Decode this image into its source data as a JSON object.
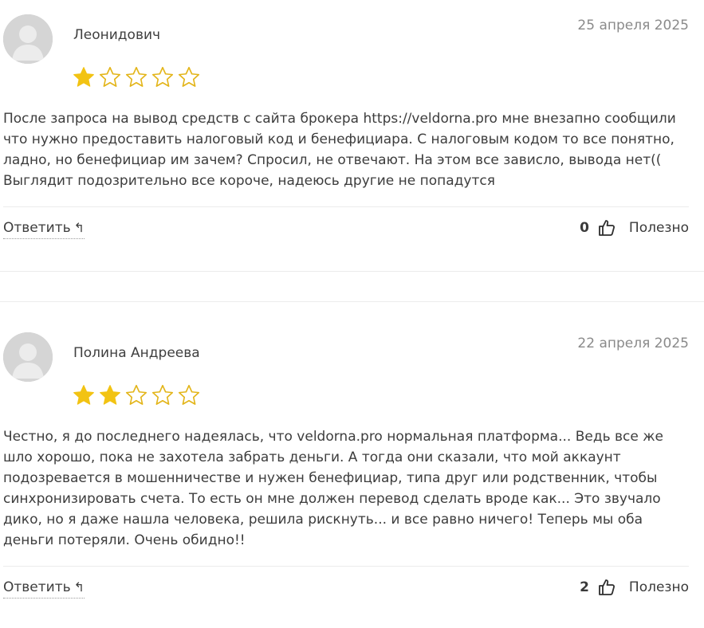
{
  "colors": {
    "star_filled": "#f2c313",
    "star_empty_stroke": "#e3b51a",
    "avatar_bg": "#d5d5d5"
  },
  "reviews": [
    {
      "author": "Леонидович",
      "date": "25 апреля 2025",
      "rating": 1,
      "max_rating": 5,
      "text": "После запроса на вывод средств с сайта брокера https://veldorna.pro мне внезапно сообщили что нужно предоставить налоговый код и бенефициара. С налоговым кодом то все понятно, ладно, но бенефициар им зачем? Спросил, не отвечают. На этом все зависло, вывода нет(( Выглядит подозрительно все короче, надеюсь другие не попадутся",
      "reply_label": "Ответить",
      "reply_icon": "reply-arrow-icon",
      "helpful_count": "0",
      "helpful_icon": "thumbs-up-icon",
      "helpful_label": "Полезно"
    },
    {
      "author": "Полина Андреева",
      "date": "22 апреля 2025",
      "rating": 2,
      "max_rating": 5,
      "text": "Честно, я до последнего надеялась, что veldorna.pro нормальная платформа... Ведь все же шло хорошо, пока не захотела забрать деньги. А тогда они сказали, что мой аккаунт подозревается в мошенничестве и нужен бенефициар, типа друг или родственник, чтобы синхронизировать счета. То есть он мне должен перевод сделать вроде как... Это звучало дико, но я даже нашла человека, решила рискнуть... и все равно ничего! Теперь мы оба деньги потеряли. Очень обидно!!",
      "reply_label": "Ответить",
      "reply_icon": "reply-arrow-icon",
      "helpful_count": "2",
      "helpful_icon": "thumbs-up-icon",
      "helpful_label": "Полезно"
    }
  ]
}
